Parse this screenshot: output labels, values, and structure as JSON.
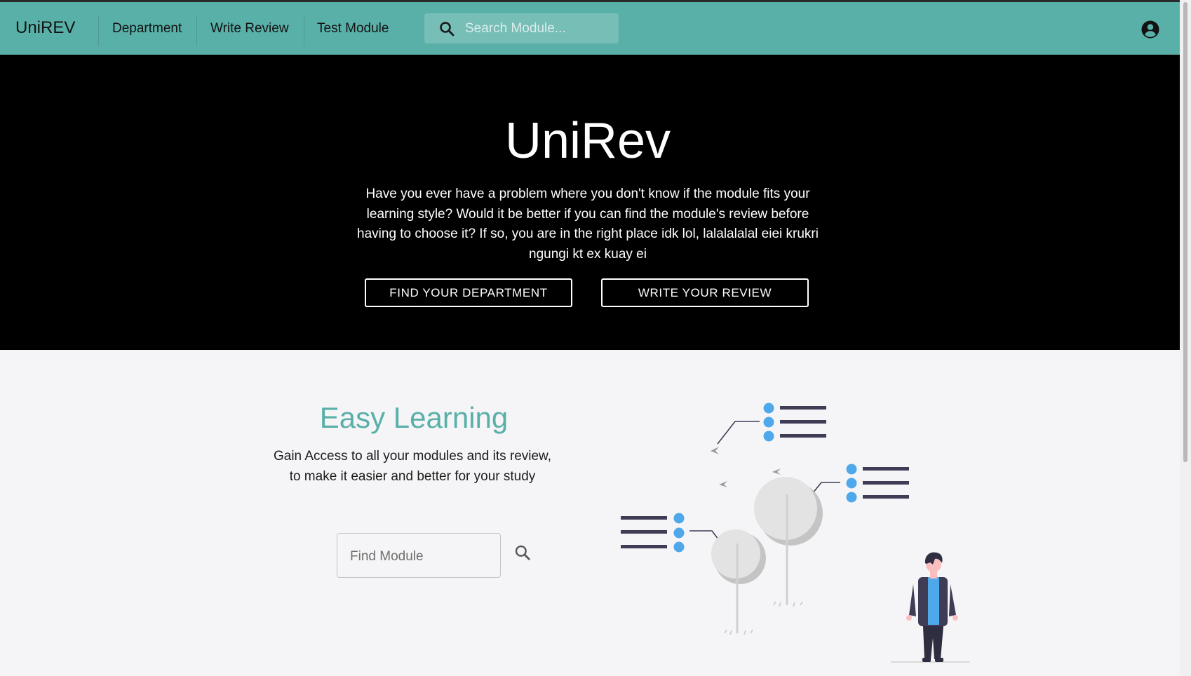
{
  "navbar": {
    "brand": "UniREV",
    "links": [
      "Department",
      "Write Review",
      "Test Module"
    ],
    "search_placeholder": "Search Module..."
  },
  "hero": {
    "title": "UniRev",
    "description": "Have you ever have a problem where you don't know if the module fits your learning style? Would it be better if you can find the module's review before having to choose it? If so, you are in the right place idk lol, lalalalalal eiei krukri ngungi kt ex kuay ei",
    "buttons": [
      "FIND YOUR DEPARTMENT",
      "WRITE YOUR REVIEW"
    ]
  },
  "feature": {
    "title": "Easy Learning",
    "description": "Gain Access to all your modules and its review, to make it easier and better for your study",
    "find_placeholder": "Find Module"
  },
  "colors": {
    "accent": "#59b0a8",
    "hero_background": "#000000",
    "page_background": "#f5f5f7",
    "illustration_blue": "#4fa8ea",
    "illustration_dark": "#3f3d56"
  },
  "icons": [
    "search-icon",
    "account-circle-icon"
  ]
}
